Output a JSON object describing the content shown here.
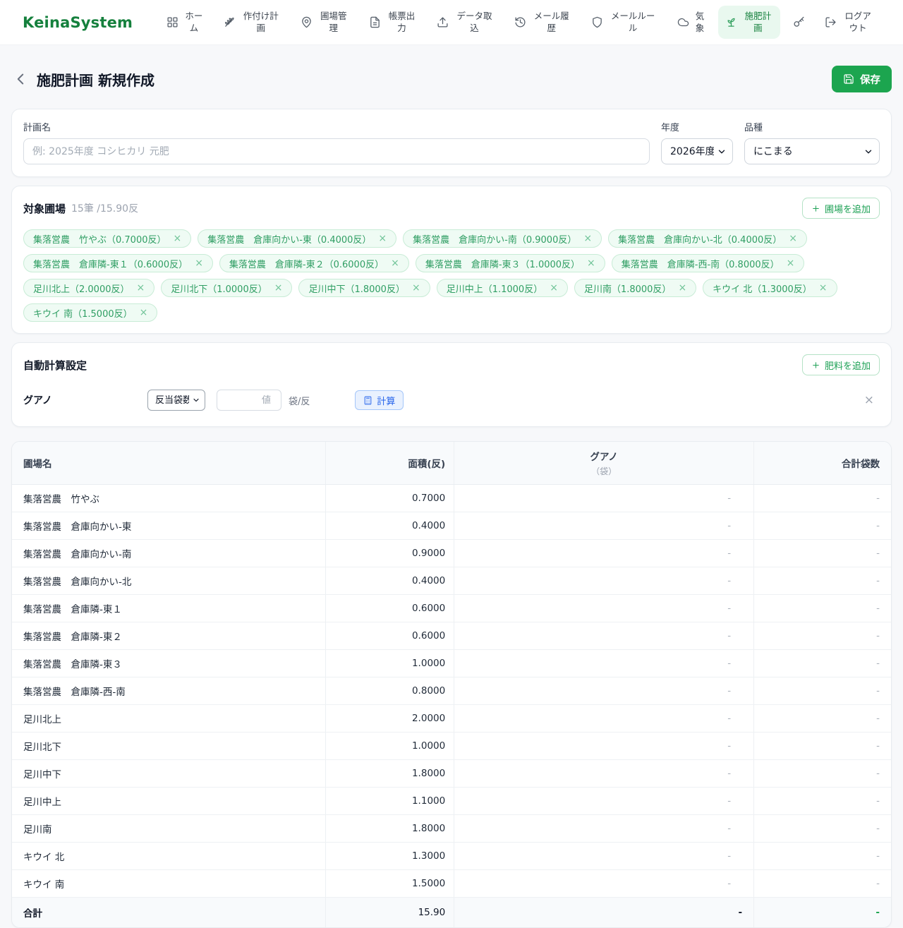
{
  "brand": "KeinaSystem",
  "colors": {
    "brand_green": "#15803d",
    "save_button_green": "#1ca54f",
    "active_nav_bg": "#e9f8ef",
    "tag_green_text": "#2f9e63",
    "tag_green_bg": "#effbf4",
    "calc_button_blue": "#2563eb",
    "total_dash_green": "#16a34a"
  },
  "nav": {
    "items": [
      {
        "id": "home",
        "icon": "grid",
        "label": "ホーム"
      },
      {
        "id": "planting",
        "icon": "wheat",
        "label": "作付け計画"
      },
      {
        "id": "fields",
        "icon": "pin",
        "label": "圃場管理"
      },
      {
        "id": "reports",
        "icon": "document",
        "label": "帳票出力"
      },
      {
        "id": "import",
        "icon": "upload",
        "label": "データ取込"
      },
      {
        "id": "mail-history",
        "icon": "history",
        "label": "メール履歴"
      },
      {
        "id": "mail-rules",
        "icon": "shield",
        "label": "メールルール"
      },
      {
        "id": "weather",
        "icon": "cloud",
        "label": "気象"
      },
      {
        "id": "fertilization",
        "icon": "sprout",
        "label": "施肥計画",
        "active": true
      },
      {
        "id": "key",
        "icon": "key",
        "label": ""
      },
      {
        "id": "logout",
        "icon": "logout",
        "label": "ログアウト"
      }
    ]
  },
  "header": {
    "title": "施肥計画 新規作成",
    "save_label": "保存"
  },
  "form": {
    "plan_name_label": "計画名",
    "plan_name_placeholder": "例: 2025年度 コシヒカリ 元肥",
    "year_label": "年度",
    "year_value": "2026年度",
    "variety_label": "品種",
    "variety_value": "にこまる"
  },
  "target_fields": {
    "title": "対象圃場",
    "count_summary": "15筆 /15.90反",
    "add_field_label": "圃場を追加",
    "tags": [
      "集落営農　竹やぶ（0.7000反）",
      "集落営農　倉庫向かい-東（0.4000反）",
      "集落営農　倉庫向かい-南（0.9000反）",
      "集落営農　倉庫向かい-北（0.4000反）",
      "集落営農　倉庫隣-東１（0.6000反）",
      "集落営農　倉庫隣-東２（0.6000反）",
      "集落営農　倉庫隣-東３（1.0000反）",
      "集落営農　倉庫隣-西-南（0.8000反）",
      "足川北上（2.0000反）",
      "足川北下（1.0000反）",
      "足川中下（1.8000反）",
      "足川中上（1.1000反）",
      "足川南（1.8000反）",
      "キウイ 北（1.3000反）",
      "キウイ 南（1.5000反）"
    ]
  },
  "auto_calc": {
    "title": "自動計算設定",
    "add_fertilizer_label": "肥料を追加",
    "row": {
      "fertilizer_name": "グアノ",
      "method_value": "反当袋数",
      "value_placeholder": "値",
      "unit": "袋/反",
      "calc_label": "計算"
    }
  },
  "table": {
    "headers": {
      "field_name": "圃場名",
      "area": "面積(反)",
      "guano": "グアノ",
      "guano_unit": "（袋）",
      "total_bags": "合計袋数"
    },
    "rows": [
      {
        "name": "集落営農　竹やぶ",
        "area": "0.7000",
        "guano": "-",
        "total": "-"
      },
      {
        "name": "集落営農　倉庫向かい-東",
        "area": "0.4000",
        "guano": "-",
        "total": "-"
      },
      {
        "name": "集落営農　倉庫向かい-南",
        "area": "0.9000",
        "guano": "-",
        "total": "-"
      },
      {
        "name": "集落営農　倉庫向かい-北",
        "area": "0.4000",
        "guano": "-",
        "total": "-"
      },
      {
        "name": "集落営農　倉庫隣-東１",
        "area": "0.6000",
        "guano": "-",
        "total": "-"
      },
      {
        "name": "集落営農　倉庫隣-東２",
        "area": "0.6000",
        "guano": "-",
        "total": "-"
      },
      {
        "name": "集落営農　倉庫隣-東３",
        "area": "1.0000",
        "guano": "-",
        "total": "-"
      },
      {
        "name": "集落営農　倉庫隣-西-南",
        "area": "0.8000",
        "guano": "-",
        "total": "-"
      },
      {
        "name": "足川北上",
        "area": "2.0000",
        "guano": "-",
        "total": "-"
      },
      {
        "name": "足川北下",
        "area": "1.0000",
        "guano": "-",
        "total": "-"
      },
      {
        "name": "足川中下",
        "area": "1.8000",
        "guano": "-",
        "total": "-"
      },
      {
        "name": "足川中上",
        "area": "1.1000",
        "guano": "-",
        "total": "-"
      },
      {
        "name": "足川南",
        "area": "1.8000",
        "guano": "-",
        "total": "-"
      },
      {
        "name": "キウイ 北",
        "area": "1.3000",
        "guano": "-",
        "total": "-"
      },
      {
        "name": "キウイ 南",
        "area": "1.5000",
        "guano": "-",
        "total": "-"
      }
    ],
    "footer": {
      "name": "合計",
      "area": "15.90",
      "guano": "-",
      "total": "-"
    }
  }
}
